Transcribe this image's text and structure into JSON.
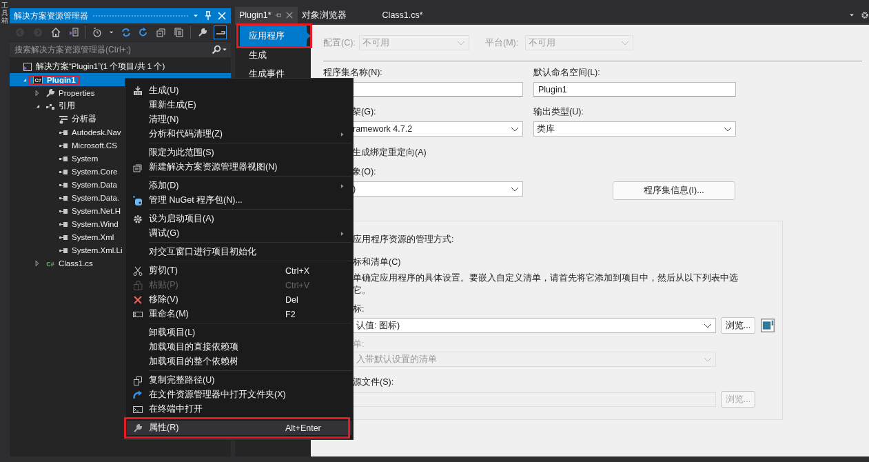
{
  "left_strip": {
    "label": "工具箱"
  },
  "explorer": {
    "title": "解决方案资源管理器",
    "toolbar": [
      {
        "kind": "back",
        "disabled": true,
        "on": false
      },
      {
        "kind": "forward",
        "disabled": true,
        "on": false
      },
      {
        "kind": "home",
        "disabled": false,
        "on": false
      },
      {
        "kind": "switch",
        "disabled": false,
        "on": false
      },
      {
        "kind": "separator"
      },
      {
        "kind": "pending",
        "disabled": false,
        "on": false
      },
      {
        "kind": "sync",
        "disabled": false,
        "on": false
      },
      {
        "kind": "refresh",
        "disabled": false,
        "on": false
      },
      {
        "kind": "collapse",
        "disabled": false,
        "on": false
      },
      {
        "kind": "showall",
        "disabled": false,
        "on": false
      },
      {
        "kind": "separator"
      },
      {
        "kind": "properties",
        "disabled": false,
        "on": false
      },
      {
        "kind": "preview",
        "disabled": false,
        "on": true
      }
    ],
    "search": {
      "placeholder": "搜索解决方案资源管理器(Ctrl+;)"
    },
    "solution": {
      "label": "解决方案“Plugin1”(1 个项目/共 1 个)"
    },
    "tree": [
      {
        "label": "Plugin1",
        "kind": "csproject",
        "icon_text": "C#",
        "expanded": true,
        "selected": true,
        "highlighted": true,
        "children": [
          {
            "label": "Properties",
            "kind": "properties",
            "expanded": false,
            "selected": false,
            "highlighted": false
          },
          {
            "label": "引用",
            "kind": "references",
            "expanded": true,
            "selected": false,
            "highlighted": false,
            "children": [
              {
                "label": "分析器",
                "kind": "analyzer",
                "selected": false,
                "highlighted": false
              },
              {
                "label": "Autodesk.Nav",
                "kind": "reference",
                "selected": false,
                "highlighted": false
              },
              {
                "label": "Microsoft.CS",
                "kind": "reference",
                "selected": false,
                "highlighted": false
              },
              {
                "label": "System",
                "kind": "reference",
                "selected": false,
                "highlighted": false
              },
              {
                "label": "System.Core",
                "kind": "reference",
                "selected": false,
                "highlighted": false
              },
              {
                "label": "System.Data",
                "kind": "reference",
                "selected": false,
                "highlighted": false
              },
              {
                "label": "System.Data.",
                "kind": "reference",
                "selected": false,
                "highlighted": false
              },
              {
                "label": "System.Net.H",
                "kind": "reference",
                "selected": false,
                "highlighted": false
              },
              {
                "label": "System.Wind",
                "kind": "reference",
                "selected": false,
                "highlighted": false
              },
              {
                "label": "System.Xml",
                "kind": "reference",
                "selected": false,
                "highlighted": false
              },
              {
                "label": "System.Xml.Li",
                "kind": "reference",
                "selected": false,
                "highlighted": false
              }
            ]
          },
          {
            "label": "Class1.cs",
            "kind": "csfile",
            "icon_text": "C#",
            "expanded": false,
            "selected": false,
            "highlighted": false
          }
        ]
      }
    ]
  },
  "editor_tabs": [
    {
      "label": "Plugin1*",
      "selected": true
    },
    {
      "label": "对象浏览器",
      "selected": false
    },
    {
      "label": "Class1.cs*",
      "selected": false
    }
  ],
  "nav": [
    {
      "label": "应用程序",
      "selected": true,
      "highlighted": true
    },
    {
      "label": "生成",
      "selected": false,
      "highlighted": false
    },
    {
      "label": "生成事件",
      "selected": false,
      "highlighted": false
    }
  ],
  "page": {
    "config": [
      {
        "label": "配置(C):",
        "value": "不可用",
        "disabled": true
      },
      {
        "label": "平台(M):",
        "value": "不可用",
        "disabled": true
      }
    ],
    "assembly_name": {
      "label": "程序集名称(N):"
    },
    "default_namespace": {
      "label": "默认命名空间(L):",
      "value": "Plugin1"
    },
    "target_framework": {
      "label": "架(G):",
      "value": "ramework 4.7.2"
    },
    "output_type": {
      "label": "输出类型(U):",
      "value": "类库"
    },
    "binding_redirect": {
      "label": "生成绑定重定向(A)"
    },
    "startup_object": {
      "label": "象(O):",
      "value": ")"
    },
    "assembly_info_button": "程序集信息(I)...",
    "resources": {
      "title": "应用程序资源的管理方式:",
      "option": "标和清单(C)",
      "description": [
        "单确定应用程序的具体设置。要嵌入自定义清单，请首先将它添加到项目中，然后从以下列表中选",
        "它。"
      ],
      "icon": {
        "label": "标:",
        "value": "认值: 图标)",
        "browse": "浏览...",
        "disabled": false
      },
      "manifest": {
        "label": "单:",
        "value": "入带默认设置的清单",
        "disabled": true
      },
      "resource_file": {
        "label": "源文件(S):",
        "browse": "浏览...",
        "disabled": true
      }
    }
  },
  "context_menu": [
    {
      "kind": "item",
      "label": "生成(U)",
      "disabled": false,
      "submenu": false,
      "hovered": false,
      "highlighted": false
    },
    {
      "kind": "item",
      "label": "重新生成(E)",
      "disabled": false,
      "submenu": false,
      "hovered": false,
      "highlighted": false
    },
    {
      "kind": "item",
      "label": "清理(N)",
      "disabled": false,
      "submenu": false,
      "hovered": false,
      "highlighted": false
    },
    {
      "kind": "item",
      "label": "分析和代码清理(Z)",
      "disabled": false,
      "submenu": true,
      "hovered": false,
      "highlighted": false
    },
    {
      "kind": "separator"
    },
    {
      "kind": "item",
      "label": "限定为此范围(S)",
      "disabled": false,
      "submenu": false,
      "hovered": false,
      "highlighted": false
    },
    {
      "kind": "item",
      "label": "新建解决方案资源管理器视图(N)",
      "disabled": false,
      "submenu": false,
      "hovered": false,
      "highlighted": false
    },
    {
      "kind": "separator"
    },
    {
      "kind": "item",
      "label": "添加(D)",
      "disabled": false,
      "submenu": true,
      "hovered": false,
      "highlighted": false
    },
    {
      "kind": "item",
      "label": "管理 NuGet 程序包(N)...",
      "disabled": false,
      "submenu": false,
      "hovered": false,
      "highlighted": false
    },
    {
      "kind": "separator"
    },
    {
      "kind": "item",
      "label": "设为启动项目(A)",
      "disabled": false,
      "submenu": false,
      "hovered": false,
      "highlighted": false
    },
    {
      "kind": "item",
      "label": "调试(G)",
      "disabled": false,
      "submenu": true,
      "hovered": false,
      "highlighted": false
    },
    {
      "kind": "separator"
    },
    {
      "kind": "item",
      "label": "对交互窗口进行项目初始化",
      "disabled": false,
      "submenu": false,
      "hovered": false,
      "highlighted": false
    },
    {
      "kind": "separator"
    },
    {
      "kind": "item",
      "label": "剪切(T)",
      "shortcut": "Ctrl+X",
      "disabled": false,
      "submenu": false,
      "hovered": false,
      "highlighted": false
    },
    {
      "kind": "item",
      "label": "粘贴(P)",
      "shortcut": "Ctrl+V",
      "disabled": true,
      "submenu": false,
      "hovered": false,
      "highlighted": false
    },
    {
      "kind": "item",
      "label": "移除(V)",
      "shortcut": "Del",
      "disabled": false,
      "submenu": false,
      "hovered": false,
      "highlighted": false
    },
    {
      "kind": "item",
      "label": "重命名(M)",
      "shortcut": "F2",
      "disabled": false,
      "submenu": false,
      "hovered": false,
      "highlighted": false
    },
    {
      "kind": "separator"
    },
    {
      "kind": "item",
      "label": "卸载项目(L)",
      "disabled": false,
      "submenu": false,
      "hovered": false,
      "highlighted": false
    },
    {
      "kind": "item",
      "label": "加载项目的直接依赖项",
      "disabled": false,
      "submenu": false,
      "hovered": false,
      "highlighted": false
    },
    {
      "kind": "item",
      "label": "加载项目的整个依赖树",
      "disabled": false,
      "submenu": false,
      "hovered": false,
      "highlighted": false
    },
    {
      "kind": "separator"
    },
    {
      "kind": "item",
      "label": "复制完整路径(U)",
      "disabled": false,
      "submenu": false,
      "hovered": false,
      "highlighted": false
    },
    {
      "kind": "item",
      "label": "在文件资源管理器中打开文件夹(X)",
      "disabled": false,
      "submenu": false,
      "hovered": false,
      "highlighted": false
    },
    {
      "kind": "item",
      "label": "在终端中打开",
      "disabled": false,
      "submenu": false,
      "hovered": false,
      "highlighted": false
    },
    {
      "kind": "separator"
    },
    {
      "kind": "item",
      "label": "属性(R)",
      "shortcut": "Alt+Enter",
      "disabled": false,
      "submenu": false,
      "hovered": true,
      "highlighted": true
    }
  ]
}
